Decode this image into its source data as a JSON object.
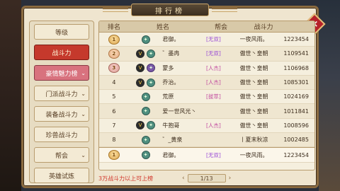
{
  "window": {
    "title": "排行榜"
  },
  "sidebar": {
    "tabs": [
      {
        "label": "等级",
        "state": "normal"
      },
      {
        "label": "战斗力",
        "state": "active"
      },
      {
        "label": "豪情魅力榜",
        "state": "pink",
        "chevron": "⌄"
      },
      {
        "label": "门派战斗力",
        "state": "normal",
        "chevron": "⌄"
      },
      {
        "label": "装备战斗力",
        "state": "normal",
        "chevron": "⌄"
      },
      {
        "label": "珍兽战斗力",
        "state": "normal"
      },
      {
        "label": "帮会",
        "state": "normal",
        "chevron": "⌄"
      },
      {
        "label": "英雄试炼",
        "state": "normal"
      }
    ]
  },
  "table": {
    "headers": {
      "rank": "排名",
      "name": "姓名",
      "guild": "帮会",
      "power": "战斗力"
    },
    "rows": [
      {
        "rank": "1",
        "medal": "gold",
        "vip": "",
        "cls": "teal",
        "name": "君御。",
        "tag": "[无双]",
        "tag_type": "none",
        "guild": "一夜风雨。",
        "power": "1223454"
      },
      {
        "rank": "2",
        "medal": "silver",
        "vip": "V",
        "cls": "teal",
        "name": "゛墨冉",
        "tag": "[无双]",
        "tag_type": "none",
        "guild": "傲世丶皇朝",
        "power": "1109541"
      },
      {
        "rank": "3",
        "medal": "bronze",
        "vip": "V",
        "cls": "purple",
        "name": "蒙多",
        "tag": "[人杰]",
        "tag_type": "people",
        "guild": "傲世丶皇朝",
        "power": "1106968"
      },
      {
        "rank": "4",
        "medal": "",
        "vip": "V",
        "cls": "teal",
        "name": "乔治。",
        "tag": "[人杰]",
        "tag_type": "people",
        "guild": "傲世丶皇朝",
        "power": "1085301"
      },
      {
        "rank": "5",
        "medal": "",
        "vip": "",
        "cls": "teal",
        "name": "荒原",
        "tag": "[拔萃]",
        "tag_type": "opp",
        "guild": "傲世丶皇朝",
        "power": "1024169"
      },
      {
        "rank": "6",
        "medal": "",
        "vip": "",
        "cls": "teal",
        "name": "爱一世风光丶",
        "tag": "",
        "tag_type": "",
        "guild": "傲世丶皇朝",
        "power": "1011841"
      },
      {
        "rank": "7",
        "medal": "",
        "vip": "V",
        "cls": "teal",
        "name": "牛抱哥",
        "tag": "[人杰]",
        "tag_type": "people",
        "guild": "傲世丶皇朝",
        "power": "1008596"
      },
      {
        "rank": "8",
        "medal": "",
        "vip": "",
        "cls": "teal",
        "name": "゛_黄泉",
        "tag": "",
        "tag_type": "",
        "guild": "丨夏末秋凉",
        "power": "1002485"
      }
    ],
    "mine": {
      "rank": "1",
      "medal": "gold",
      "vip": "",
      "cls": "teal",
      "name": "君御。",
      "tag": "[无双]",
      "tag_type": "none",
      "guild": "一夜风雨。",
      "power": "1223454"
    }
  },
  "footer": {
    "hint": "3万战斗力以上可上榜",
    "page": "1/13",
    "prev": "‹",
    "next": "›"
  },
  "icons": {
    "close": "×"
  },
  "colors": {
    "accent_red": "#c5392c",
    "frame": "#8a6a3f",
    "hint_red": "#d2352a"
  }
}
